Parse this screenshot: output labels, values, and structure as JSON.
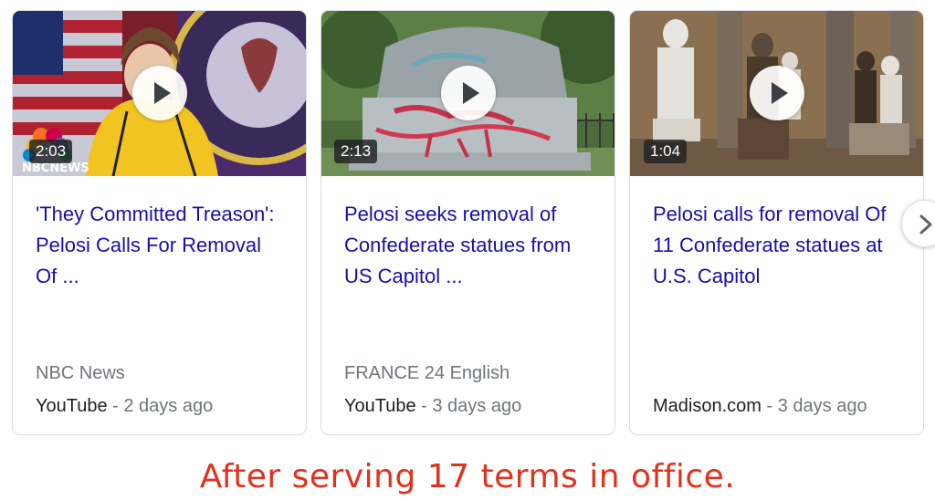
{
  "cards": [
    {
      "thumb_scene": "press-conference",
      "duration": "2:03",
      "title": "'They Committed Treason': Pelosi Calls For Removal Of ...",
      "channel": "NBC News",
      "source": "YouTube",
      "separator": " - ",
      "age": "2 days ago",
      "watermark": "NBCNEWS",
      "accent": "#f5c518"
    },
    {
      "thumb_scene": "vandalized-monument",
      "duration": "2:13",
      "title": "Pelosi seeks removal of Confederate statues from US Capitol ...",
      "channel": "FRANCE 24 English",
      "source": "YouTube",
      "separator": " - ",
      "age": "3 days ago"
    },
    {
      "thumb_scene": "statuary-hall",
      "duration": "1:04",
      "title": "Pelosi calls for removal Of 11 Confederate statues at U.S. Capitol",
      "channel": "",
      "source": "Madison.com",
      "separator": " - ",
      "age": "3 days ago"
    }
  ],
  "next_button": {
    "icon": "chevron-right-icon"
  },
  "caption": "After serving 17 terms in office.",
  "colors": {
    "title_link": "#1a0dab",
    "meta_gray": "#70757a",
    "caption_red": "#e0321c",
    "card_border": "#dadce0"
  }
}
